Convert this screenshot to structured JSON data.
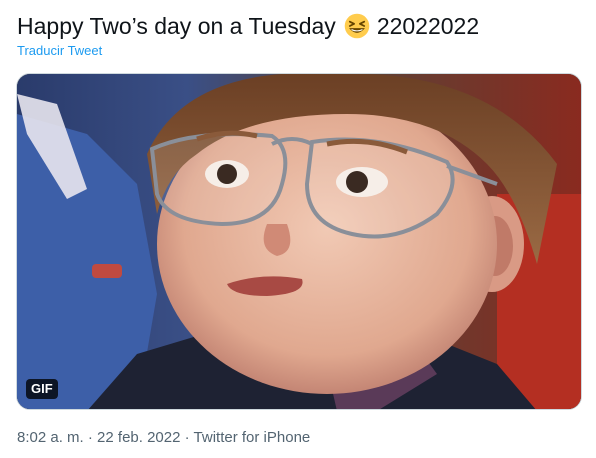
{
  "tweet": {
    "text_before": "Happy Two’s day on a Tuesday",
    "emoji": "grinning-squinting-face",
    "text_after": "22022022",
    "translate_label": "Traducir Tweet"
  },
  "media": {
    "type_badge": "GIF",
    "description_icon": "boy-with-glasses-gif"
  },
  "meta": {
    "time": "8:02 a. m.",
    "separator1": " · ",
    "date": "22 feb. 2022",
    "separator2": " · ",
    "source": "Twitter for iPhone"
  }
}
